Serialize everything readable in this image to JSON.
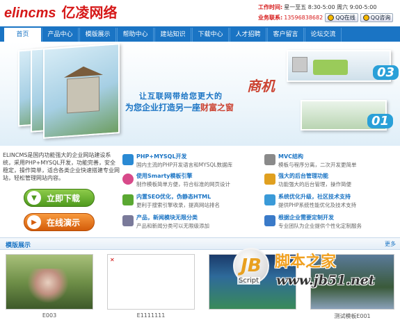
{
  "header": {
    "logo_en": "elincms",
    "logo_cn": "亿凌网络",
    "work_time_label": "工作时间:",
    "work_time_value": "星一至五 8:30-5:00 周六 9:00-5:00",
    "service_label": "业务联系:",
    "service_phone": "13596838682",
    "qq_online": "QQ在线",
    "qq_consult": "QQ咨询"
  },
  "nav": {
    "items": [
      "首页",
      "产品中心",
      "模版展示",
      "帮助中心",
      "建站知识",
      "下载中心",
      "人才招聘",
      "客户留言",
      "论坛交流"
    ]
  },
  "banner": {
    "slogan_line1": "让互联网带给您更大的",
    "slogan_big": "商机",
    "slogan_line2_a": "为您企业打造另一座",
    "slogan_line2_b": "财富之窗",
    "badge_03": "03",
    "badge_01": "01"
  },
  "intro": {
    "text": "ELINCMS是国内功能强大的企业网站建设系统，采用PHP+MYSQL开发，功能完善，安全稳定，操作简单，适合各类企业快速搭建专业网站，轻松管理网站内容。"
  },
  "buttons": {
    "download": "立即下载",
    "demo": "在线演示"
  },
  "features": [
    {
      "title": "PHP+MYSQL开发",
      "desc": "国内主流的PHP开发语言和MYSQL数据库",
      "color": "#2a8ad4"
    },
    {
      "title": "MVC结构",
      "desc": "模板与程序分离，二次开发更简单",
      "color": "#8a8a8a"
    },
    {
      "title": "使用Smarty模板引擎",
      "desc": "制作模板简单方便，符合标准的网页设计",
      "color": "#d84a8a"
    },
    {
      "title": "强大的后台管理功能",
      "desc": "功能强大的后台管理，操作简便",
      "color": "#e0a020"
    },
    {
      "title": "内置SEO优化，伪静态HTML",
      "desc": "更利于搜索引擎收录，提高网站排名",
      "color": "#5aa832"
    },
    {
      "title": "系统优化升级，社区技术支持",
      "desc": "提供PHP系统性能优化及技术支持",
      "color": "#3a9ad8"
    },
    {
      "title": "产品，新闻模块无限分类",
      "desc": "产品和新闻分类可以无限级添加",
      "color": "#7a7a9a"
    },
    {
      "title": "根据企业需要定制开发",
      "desc": "专业团队为企业提供个性化定制服务",
      "color": "#3a7ac8"
    }
  ],
  "showcase": {
    "title": "模版展示",
    "more": "更多",
    "captions": [
      "E003",
      "E1111111",
      "",
      "测试模板E001"
    ]
  },
  "watermark": {
    "logo_letters": "JB",
    "script": "Script",
    "cn": "脚本之家",
    "url": "www.jb51.net"
  }
}
